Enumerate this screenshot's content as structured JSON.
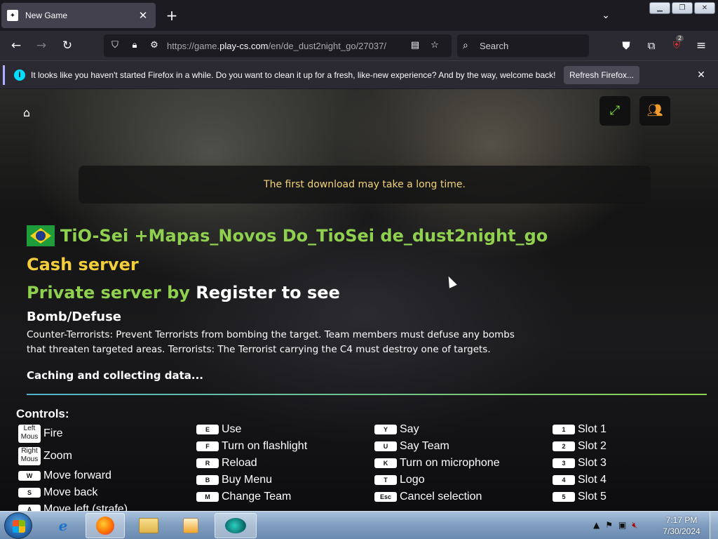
{
  "browser": {
    "tab_title": "New Game",
    "url_prefix": "https://game.",
    "url_domain": "play-cs.com",
    "url_path": "/en/de_dust2night_go/27037/",
    "search_placeholder": "Search",
    "extension_badge": "2"
  },
  "notification": {
    "text": "It looks like you haven't started Firefox in a while. Do you want to clean it up for a fresh, like-new experience? And by the way, welcome back!",
    "button_label": "Refresh Firefox..."
  },
  "page": {
    "notice": "The first download may take a long time.",
    "server_name": "TiO-Sei +Mapas_Novos Do_TioSei de_dust2night_go",
    "cash_label": "Cash server",
    "private_prefix": "Private server by",
    "private_owner": "Register to see",
    "mode_title": "Bomb/Defuse",
    "mode_description": "Counter-Terrorists: Prevent Terrorists from bombing the target. Team members must defuse any bombs that threaten targeted areas. Terrorists: The Terrorist carrying the C4 must destroy one of targets.",
    "status": "Caching and collecting data...",
    "controls_title": "Controls:"
  },
  "controls": {
    "col1": [
      {
        "key": "Left Mous",
        "label": "Fire"
      },
      {
        "key": "Right Mous",
        "label": "Zoom"
      },
      {
        "key": "W",
        "label": "Move forward"
      },
      {
        "key": "S",
        "label": "Move back"
      },
      {
        "key": "A",
        "label": "Move left (strafe)"
      }
    ],
    "col2": [
      {
        "key": "E",
        "label": "Use"
      },
      {
        "key": "F",
        "label": "Turn on flashlight"
      },
      {
        "key": "R",
        "label": "Reload"
      },
      {
        "key": "B",
        "label": "Buy Menu"
      },
      {
        "key": "M",
        "label": "Change Team"
      }
    ],
    "col3": [
      {
        "key": "Y",
        "label": "Say"
      },
      {
        "key": "U",
        "label": "Say Team"
      },
      {
        "key": "K",
        "label": "Turn on microphone"
      },
      {
        "key": "T",
        "label": "Logo"
      },
      {
        "key": "Esc",
        "label": "Cancel selection"
      }
    ],
    "col4": [
      {
        "key": "1",
        "label": "Slot 1"
      },
      {
        "key": "2",
        "label": "Slot 2"
      },
      {
        "key": "3",
        "label": "Slot 3"
      },
      {
        "key": "4",
        "label": "Slot 4"
      },
      {
        "key": "5",
        "label": "Slot 5"
      }
    ]
  },
  "taskbar": {
    "time": "7:17 PM",
    "date": "7/30/2024"
  },
  "colors": {
    "server_green": "#8fd14f",
    "cash_yellow": "#f4cd3a",
    "notice_text": "#f2d37a",
    "fullscreen_green": "#7cdb3a",
    "players_orange": "#f39b2a"
  }
}
